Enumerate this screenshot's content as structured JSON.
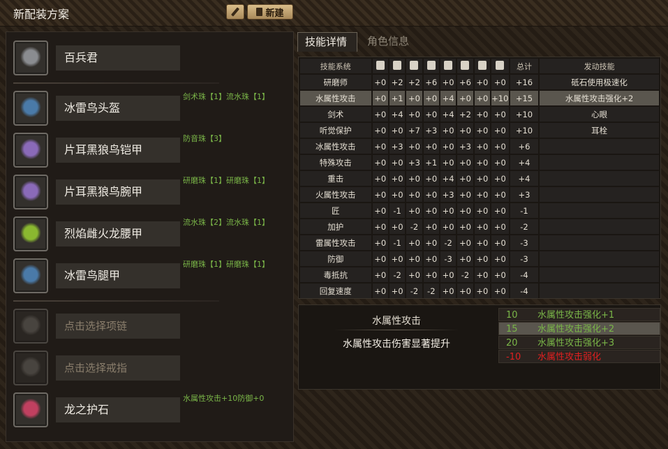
{
  "title": "新配装方案",
  "new_label": "新建",
  "tabs": [
    "技能详情",
    "角色信息"
  ],
  "equipment": [
    {
      "name": "百兵君",
      "deco": "",
      "empty": false,
      "icon": "weapon-icon",
      "color": "#8a8c90"
    },
    {
      "name": "冰雷鸟头盔",
      "deco": "剑术珠【1】流水珠【1】",
      "empty": false,
      "icon": "helmet-icon",
      "color": "#4a7aa8"
    },
    {
      "name": "片耳黑狼鸟铠甲",
      "deco": "防音珠【3】",
      "empty": false,
      "icon": "chest-icon",
      "color": "#8a6ab8"
    },
    {
      "name": "片耳黑狼鸟腕甲",
      "deco": "研磨珠【1】研磨珠【1】",
      "empty": false,
      "icon": "arms-icon",
      "color": "#8a6ab8"
    },
    {
      "name": "烈焰雌火龙腰甲",
      "deco": "流水珠【2】流水珠【1】",
      "empty": false,
      "icon": "waist-icon",
      "color": "#8ab830"
    },
    {
      "name": "冰雷鸟腿甲",
      "deco": "研磨珠【1】研磨珠【1】",
      "empty": false,
      "icon": "legs-icon",
      "color": "#4a7aa8"
    },
    {
      "name": "点击选择项链",
      "deco": "",
      "empty": true,
      "icon": "necklace-icon",
      "color": "#6a6660"
    },
    {
      "name": "点击选择戒指",
      "deco": "",
      "empty": true,
      "icon": "ring-icon",
      "color": "#6a6660"
    },
    {
      "name": "龙之护石",
      "deco": "水属性攻击+10防御+0",
      "empty": false,
      "icon": "charm-icon",
      "color": "#c04060"
    }
  ],
  "table": {
    "headers": {
      "skill": "技能系统",
      "total": "总计",
      "active": "发动技能"
    },
    "header_icons": [
      "weapon-icon",
      "helmet-icon",
      "chest-icon",
      "arms-icon",
      "waist-icon",
      "legs-icon",
      "necklace-icon",
      "ring-icon"
    ],
    "rows": [
      {
        "skill": "研磨师",
        "vals": [
          "+0",
          "+2",
          "+2",
          "+6",
          "+0",
          "+6",
          "+0",
          "+0"
        ],
        "total": "+16",
        "active": "砥石使用极速化",
        "hl": false
      },
      {
        "skill": "水属性攻击",
        "vals": [
          "+0",
          "+1",
          "+0",
          "+0",
          "+4",
          "+0",
          "+0",
          "+10"
        ],
        "total": "+15",
        "active": "水属性攻击强化+2",
        "hl": true
      },
      {
        "skill": "剑术",
        "vals": [
          "+0",
          "+4",
          "+0",
          "+0",
          "+4",
          "+2",
          "+0",
          "+0"
        ],
        "total": "+10",
        "active": "心眼",
        "hl": false
      },
      {
        "skill": "听觉保护",
        "vals": [
          "+0",
          "+0",
          "+7",
          "+3",
          "+0",
          "+0",
          "+0",
          "+0"
        ],
        "total": "+10",
        "active": "耳栓",
        "hl": false
      },
      {
        "skill": "冰属性攻击",
        "vals": [
          "+0",
          "+3",
          "+0",
          "+0",
          "+0",
          "+3",
          "+0",
          "+0"
        ],
        "total": "+6",
        "active": "",
        "hl": false
      },
      {
        "skill": "特殊攻击",
        "vals": [
          "+0",
          "+0",
          "+3",
          "+1",
          "+0",
          "+0",
          "+0",
          "+0"
        ],
        "total": "+4",
        "active": "",
        "hl": false
      },
      {
        "skill": "重击",
        "vals": [
          "+0",
          "+0",
          "+0",
          "+0",
          "+4",
          "+0",
          "+0",
          "+0"
        ],
        "total": "+4",
        "active": "",
        "hl": false
      },
      {
        "skill": "火属性攻击",
        "vals": [
          "+0",
          "+0",
          "+0",
          "+0",
          "+3",
          "+0",
          "+0",
          "+0"
        ],
        "total": "+3",
        "active": "",
        "hl": false
      },
      {
        "skill": "匠",
        "vals": [
          "+0",
          "-1",
          "+0",
          "+0",
          "+0",
          "+0",
          "+0",
          "+0"
        ],
        "total": "-1",
        "active": "",
        "hl": false
      },
      {
        "skill": "加护",
        "vals": [
          "+0",
          "+0",
          "-2",
          "+0",
          "+0",
          "+0",
          "+0",
          "+0"
        ],
        "total": "-2",
        "active": "",
        "hl": false
      },
      {
        "skill": "雷属性攻击",
        "vals": [
          "+0",
          "-1",
          "+0",
          "+0",
          "-2",
          "+0",
          "+0",
          "+0"
        ],
        "total": "-3",
        "active": "",
        "hl": false
      },
      {
        "skill": "防御",
        "vals": [
          "+0",
          "+0",
          "+0",
          "+0",
          "-3",
          "+0",
          "+0",
          "+0"
        ],
        "total": "-3",
        "active": "",
        "hl": false
      },
      {
        "skill": "毒抵抗",
        "vals": [
          "+0",
          "-2",
          "+0",
          "+0",
          "+0",
          "-2",
          "+0",
          "+0"
        ],
        "total": "-4",
        "active": "",
        "hl": false
      },
      {
        "skill": "回复速度",
        "vals": [
          "+0",
          "+0",
          "-2",
          "-2",
          "+0",
          "+0",
          "+0",
          "+0"
        ],
        "total": "-4",
        "active": "",
        "hl": false
      }
    ]
  },
  "detail": {
    "title": "水属性攻击",
    "desc": "水属性攻击伤害显著提升",
    "levels": [
      {
        "points": "10",
        "effect": "水属性攻击强化+1",
        "hl": false,
        "neg": false
      },
      {
        "points": "15",
        "effect": "水属性攻击强化+2",
        "hl": true,
        "neg": false
      },
      {
        "points": "20",
        "effect": "水属性攻击强化+3",
        "hl": false,
        "neg": false
      },
      {
        "points": "-10",
        "effect": "水属性攻击弱化",
        "hl": false,
        "neg": true
      }
    ]
  }
}
